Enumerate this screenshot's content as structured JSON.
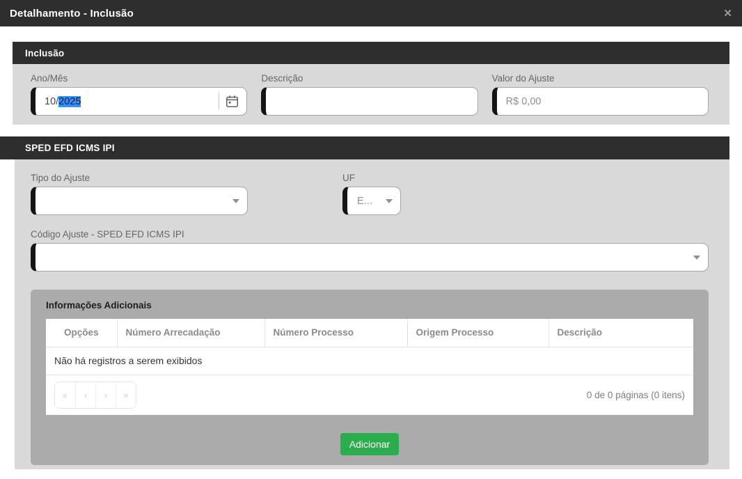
{
  "window": {
    "title": "Detalhamento - Inclusão",
    "close": "✕"
  },
  "inclusao": {
    "header": "Inclusão",
    "ano_mes": {
      "label": "Ano/Mês",
      "value_prefix": "10/",
      "value_selected": "2025"
    },
    "descricao": {
      "label": "Descrição",
      "value": ""
    },
    "valor": {
      "label": "Valor do Ajuste",
      "placeholder": "R$ 0,00"
    }
  },
  "sped": {
    "header": "SPED EFD ICMS IPI",
    "tipo_ajuste": {
      "label": "Tipo do Ajuste",
      "value": ""
    },
    "uf": {
      "label": "UF",
      "value": "E..."
    },
    "codigo_ajuste": {
      "label": "Código Ajuste - SPED EFD ICMS IPI",
      "value": ""
    }
  },
  "panel": {
    "title": "Informações Adicionais",
    "columns": [
      "Opções",
      "Número Arrecadação",
      "Número Processo",
      "Origem Processo",
      "Descrição"
    ],
    "empty_message": "Não há registros a serem exibidos",
    "pagination": {
      "first": "«",
      "prev": "‹",
      "next": "›",
      "last": "»",
      "info": "0 de 0 páginas (0 itens)"
    },
    "add_button": "Adicionar"
  },
  "colors": {
    "titlebar_bg": "#2e2e2e",
    "section_body_bg": "#d9d9d9",
    "panel_bg": "#ababab",
    "button_green": "#2bad4e",
    "selection_blue": "#3390ff"
  }
}
